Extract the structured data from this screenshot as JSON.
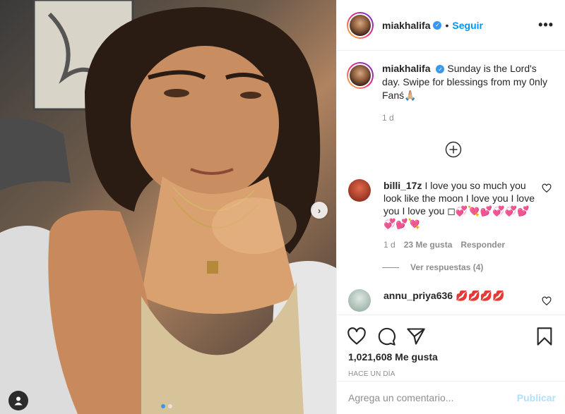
{
  "post": {
    "username": "miakhalifa",
    "verified_icon": "verified-badge-icon",
    "bullet": "•",
    "follow_label": "Seguir",
    "more_icon": "•••"
  },
  "caption": {
    "username": "miakhalifa",
    "text": "Sunday is the Lord's day. Swipe for blessings from my 0nly Fanś🙏🏼",
    "age": "1 d"
  },
  "comments": [
    {
      "username": "billi_17z",
      "text": "I love you so much you look like the moon I love you I love you I love you ◻💞💘💕💞💞💕💞💕💘",
      "age": "1 d",
      "likes": "23 Me gusta",
      "reply_label": "Responder",
      "avatar_color": "#b8402c"
    },
    {
      "username": "annu_priya636",
      "text": "💋💋💋💋",
      "avatar_color": "#a8bdb2"
    }
  ],
  "replies_label": "Ver respuestas (4)",
  "likes_count": "1,021,608 Me gusta",
  "timestamp": "HACE UN DÍA",
  "comment_input": {
    "placeholder": "Agrega un comentario...",
    "post_label": "Publicar"
  },
  "next_arrow": "›",
  "colors": {
    "accent": "#0095f6",
    "muted": "#8e8e8e",
    "post_disabled": "#b2dffc"
  }
}
